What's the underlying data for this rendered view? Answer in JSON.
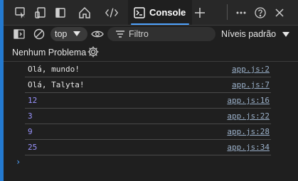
{
  "tabs": {
    "console_label": "Console"
  },
  "toolbar": {
    "context_value": "top",
    "filter_placeholder": "Filtro",
    "levels_label": "Níveis padrão"
  },
  "issues": {
    "label": "Nenhum Problema"
  },
  "console": {
    "rows": [
      {
        "message": "Olá, mundo!",
        "source": "app.js:2",
        "type": "string"
      },
      {
        "message": "Olá, Talyta!",
        "source": "app.js:7",
        "type": "string"
      },
      {
        "message": "12",
        "source": "app.js:16",
        "type": "number"
      },
      {
        "message": "3",
        "source": "app.js:22",
        "type": "number"
      },
      {
        "message": "9",
        "source": "app.js:28",
        "type": "number"
      },
      {
        "message": "25",
        "source": "app.js:34",
        "type": "number"
      }
    ],
    "prompt_symbol": "›"
  },
  "colors": {
    "string_text": "#e6e6e6",
    "number_text": "#9a94ff",
    "accent": "#4fa3ff",
    "background": "#1f1f1f",
    "left_edge": "#247ad0"
  }
}
